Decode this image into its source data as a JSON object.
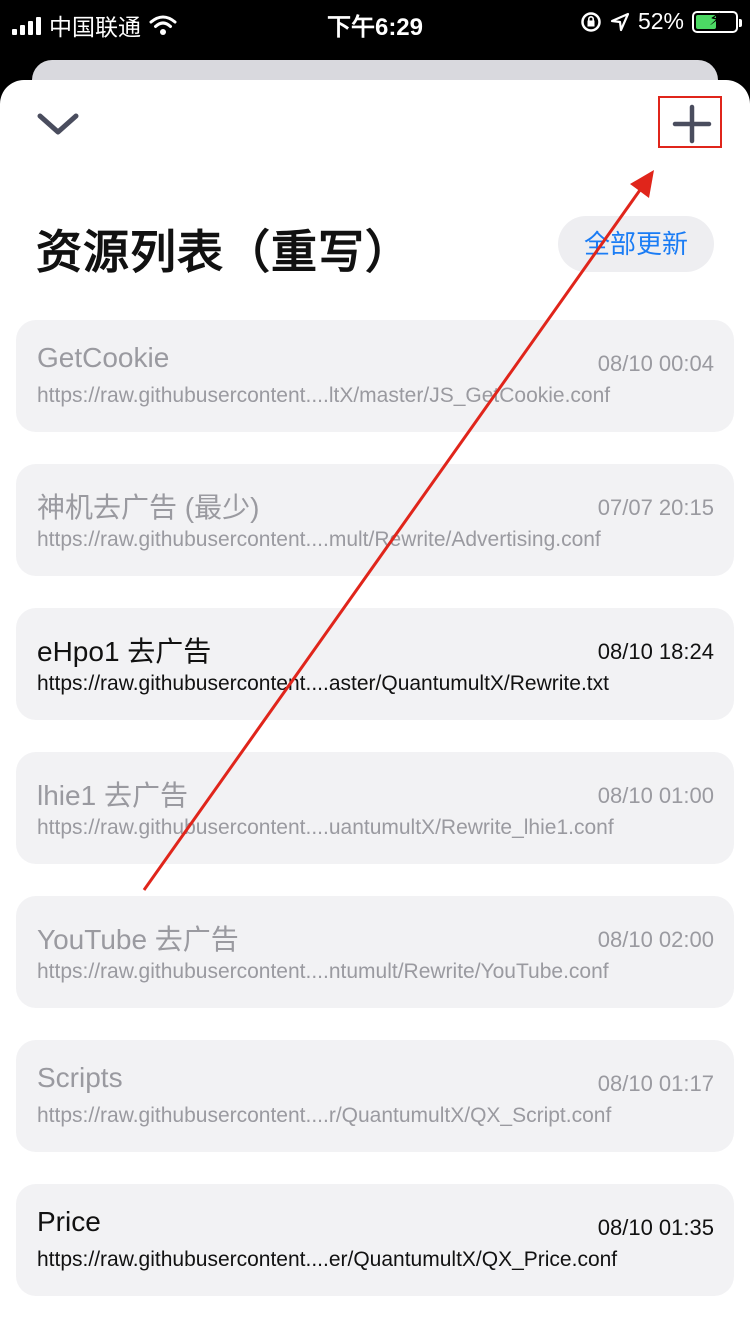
{
  "status_bar": {
    "carrier": "中国联通",
    "time": "下午6:29",
    "battery": "52%",
    "battery_level": 0.52
  },
  "header": {
    "title": "资源列表（重写）",
    "update_all_label": "全部更新"
  },
  "colors": {
    "accent": "#1a7cf5",
    "annotation": "#e0251b"
  },
  "resources": [
    {
      "name": "GetCookie",
      "time": "08/10 00:04",
      "url": "https://raw.githubusercontent....ltX/master/JS_GetCookie.conf",
      "enabled": false
    },
    {
      "name": "神机去广告 (最少)",
      "time": "07/07 20:15",
      "url": "https://raw.githubusercontent....mult/Rewrite/Advertising.conf",
      "enabled": false
    },
    {
      "name": "eHpo1 去广告",
      "time": "08/10 18:24",
      "url": "https://raw.githubusercontent....aster/QuantumultX/Rewrite.txt",
      "enabled": true
    },
    {
      "name": "lhie1 去广告",
      "time": "08/10 01:00",
      "url": "https://raw.githubusercontent....uantumultX/Rewrite_lhie1.conf",
      "enabled": false
    },
    {
      "name": "YouTube 去广告",
      "time": "08/10 02:00",
      "url": "https://raw.githubusercontent....ntumult/Rewrite/YouTube.conf",
      "enabled": false
    },
    {
      "name": "Scripts",
      "time": "08/10 01:17",
      "url": "https://raw.githubusercontent....r/QuantumultX/QX_Script.conf",
      "enabled": false
    },
    {
      "name": "Price",
      "time": "08/10 01:35",
      "url": "https://raw.githubusercontent....er/QuantumultX/QX_Price.conf",
      "enabled": true
    }
  ]
}
